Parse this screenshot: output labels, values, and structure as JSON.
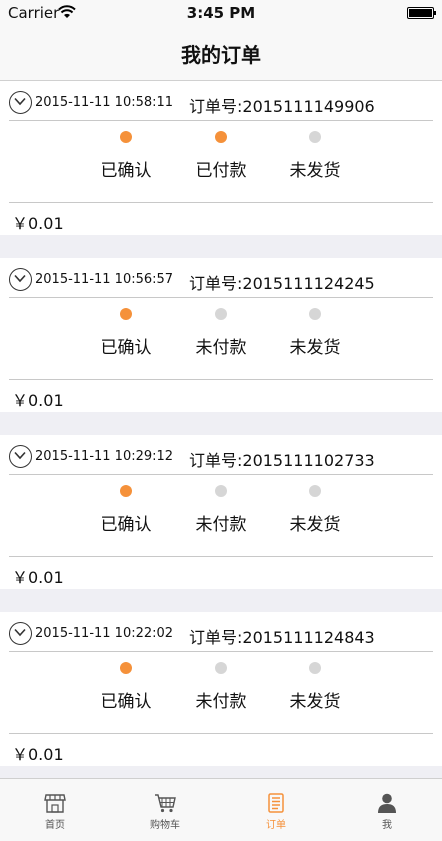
{
  "status_bar": {
    "carrier": "Carrier",
    "time": "3:45 PM"
  },
  "nav": {
    "title": "我的订单"
  },
  "orders": [
    {
      "time": "2015-11-11 10:58:11",
      "order_no": "订单号:2015111149906",
      "price": "￥0.01",
      "steps": [
        {
          "label": "已确认",
          "active": true
        },
        {
          "label": "已付款",
          "active": true
        },
        {
          "label": "未发货",
          "active": false
        }
      ]
    },
    {
      "time": "2015-11-11 10:56:57",
      "order_no": "订单号:2015111124245",
      "price": "￥0.01",
      "steps": [
        {
          "label": "已确认",
          "active": true
        },
        {
          "label": "未付款",
          "active": false
        },
        {
          "label": "未发货",
          "active": false
        }
      ]
    },
    {
      "time": "2015-11-11 10:29:12",
      "order_no": "订单号:2015111102733",
      "price": "￥0.01",
      "steps": [
        {
          "label": "已确认",
          "active": true
        },
        {
          "label": "未付款",
          "active": false
        },
        {
          "label": "未发货",
          "active": false
        }
      ]
    },
    {
      "time": "2015-11-11 10:22:02",
      "order_no": "订单号:2015111124843",
      "price": "￥0.01",
      "steps": [
        {
          "label": "已确认",
          "active": true
        },
        {
          "label": "未付款",
          "active": false
        },
        {
          "label": "未发货",
          "active": false
        }
      ]
    }
  ],
  "tabs": [
    {
      "label": "首页",
      "icon": "store-icon",
      "active": false
    },
    {
      "label": "购物车",
      "icon": "cart-icon",
      "active": false
    },
    {
      "label": "订单",
      "icon": "order-list-icon",
      "active": true
    },
    {
      "label": "我",
      "icon": "person-icon",
      "active": false
    }
  ],
  "colors": {
    "accent": "#f5913a",
    "inactive_dot": "#d6d6d6",
    "separator": "#efeff4"
  }
}
